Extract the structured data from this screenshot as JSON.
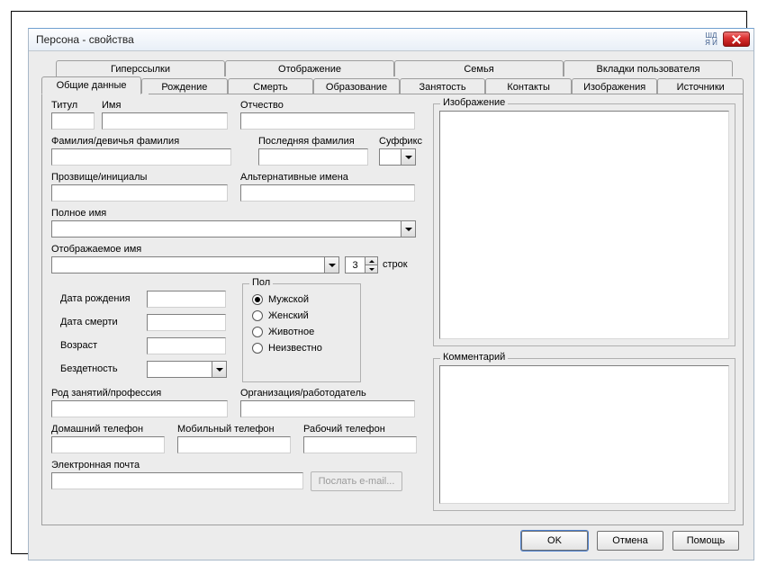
{
  "title": "Персона - свойства",
  "tabs_top": [
    "Гиперссылки",
    "Отображение",
    "Семья",
    "Вкладки пользователя"
  ],
  "tabs_bot": [
    "Общие данные",
    "Рождение",
    "Смерть",
    "Образование",
    "Занятость",
    "Контакты",
    "Изображения",
    "Источники"
  ],
  "labels": {
    "titul": "Титул",
    "name": "Имя",
    "patronymic": "Отчество",
    "surname": "Фамилия/девичья фамилия",
    "lastSurname": "Последняя фамилия",
    "suffix": "Суффикс",
    "nickname": "Прозвище/инициалы",
    "altNames": "Альтернативные имена",
    "fullName": "Полное имя",
    "displayName": "Отображаемое имя",
    "lines": "строк",
    "dob": "Дата рождения",
    "dod": "Дата смерти",
    "age": "Возраст",
    "childless": "Бездетность",
    "gender": "Пол",
    "genderOptions": [
      "Мужской",
      "Женский",
      "Животное",
      "Неизвестно"
    ],
    "occupation": "Род занятий/профессия",
    "organization": "Организация/работодатель",
    "homePhone": "Домашний телефон",
    "mobilePhone": "Мобильный телефон",
    "workPhone": "Рабочий телефон",
    "email": "Электронная почта",
    "sendEmail": "Послать e-mail...",
    "image": "Изображение",
    "comment": "Комментарий"
  },
  "values": {
    "displayLines": "3",
    "genderSelected": 0
  },
  "buttons": {
    "ok": "OK",
    "cancel": "Отмена",
    "help": "Помощь"
  }
}
